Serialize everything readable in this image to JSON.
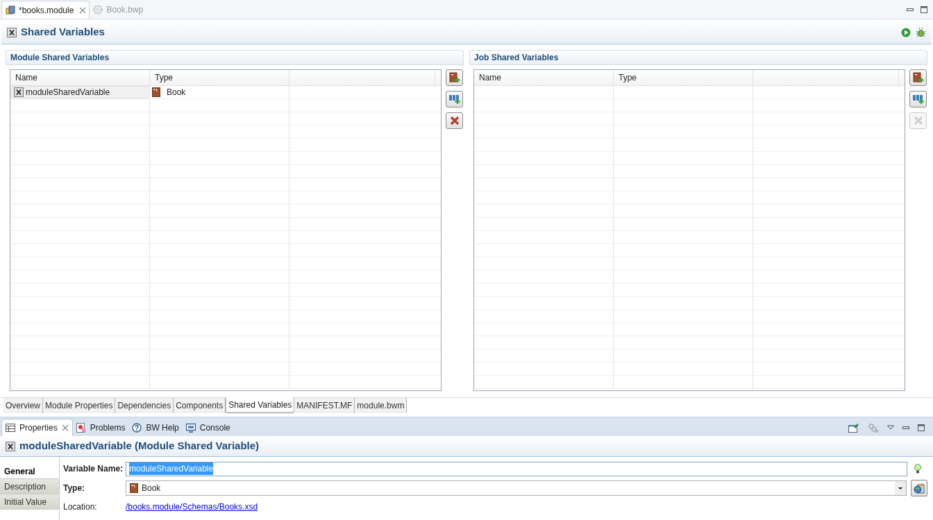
{
  "editor_tabs": [
    {
      "label": "*books.module",
      "selected": true
    },
    {
      "label": "Book.bwp",
      "selected": false
    }
  ],
  "editor_title": "Shared Variables",
  "sections": [
    {
      "title": "Module Shared Variables",
      "columns": [
        "Name",
        "Type"
      ],
      "rows": [
        {
          "name": "moduleSharedVariable",
          "type": "Book",
          "selected": true
        }
      ],
      "buttons": [
        {
          "kind": "add-element",
          "disabled": false
        },
        {
          "kind": "add-simple",
          "disabled": false
        },
        {
          "kind": "remove",
          "disabled": false
        }
      ]
    },
    {
      "title": "Job Shared Variables",
      "columns": [
        "Name",
        "Type"
      ],
      "buttons": [
        {
          "kind": "add-element",
          "disabled": false
        },
        {
          "kind": "add-simple",
          "disabled": false
        },
        {
          "kind": "remove",
          "disabled": true
        }
      ]
    }
  ],
  "page_tabs": [
    {
      "label": "Overview",
      "selected": false
    },
    {
      "label": "Module Properties",
      "selected": false
    },
    {
      "label": "Dependencies",
      "selected": false
    },
    {
      "label": "Components",
      "selected": false
    },
    {
      "label": "Shared Variables",
      "selected": true
    },
    {
      "label": "MANIFEST.MF",
      "selected": false
    },
    {
      "label": "module.bwm",
      "selected": false
    }
  ],
  "view_tabs": [
    {
      "label": "Properties",
      "kind": "properties",
      "selected": true
    },
    {
      "label": "Problems",
      "kind": "problems",
      "selected": false
    },
    {
      "label": "BW Help",
      "kind": "help",
      "selected": false
    },
    {
      "label": "Console",
      "kind": "console",
      "selected": false
    }
  ],
  "properties_title": "moduleSharedVariable (Module Shared Variable)",
  "side_tabs": [
    {
      "label": "General",
      "selected": true
    },
    {
      "label": "Description",
      "selected": false
    },
    {
      "label": "Initial Value",
      "selected": false
    }
  ],
  "form": {
    "variable_name_label": "Variable Name:",
    "variable_name": "moduleSharedVariable",
    "type_label": "Type:",
    "type": "Book",
    "location_label": "Location:",
    "location": "/books.module/Schemas/Books.xsd"
  }
}
